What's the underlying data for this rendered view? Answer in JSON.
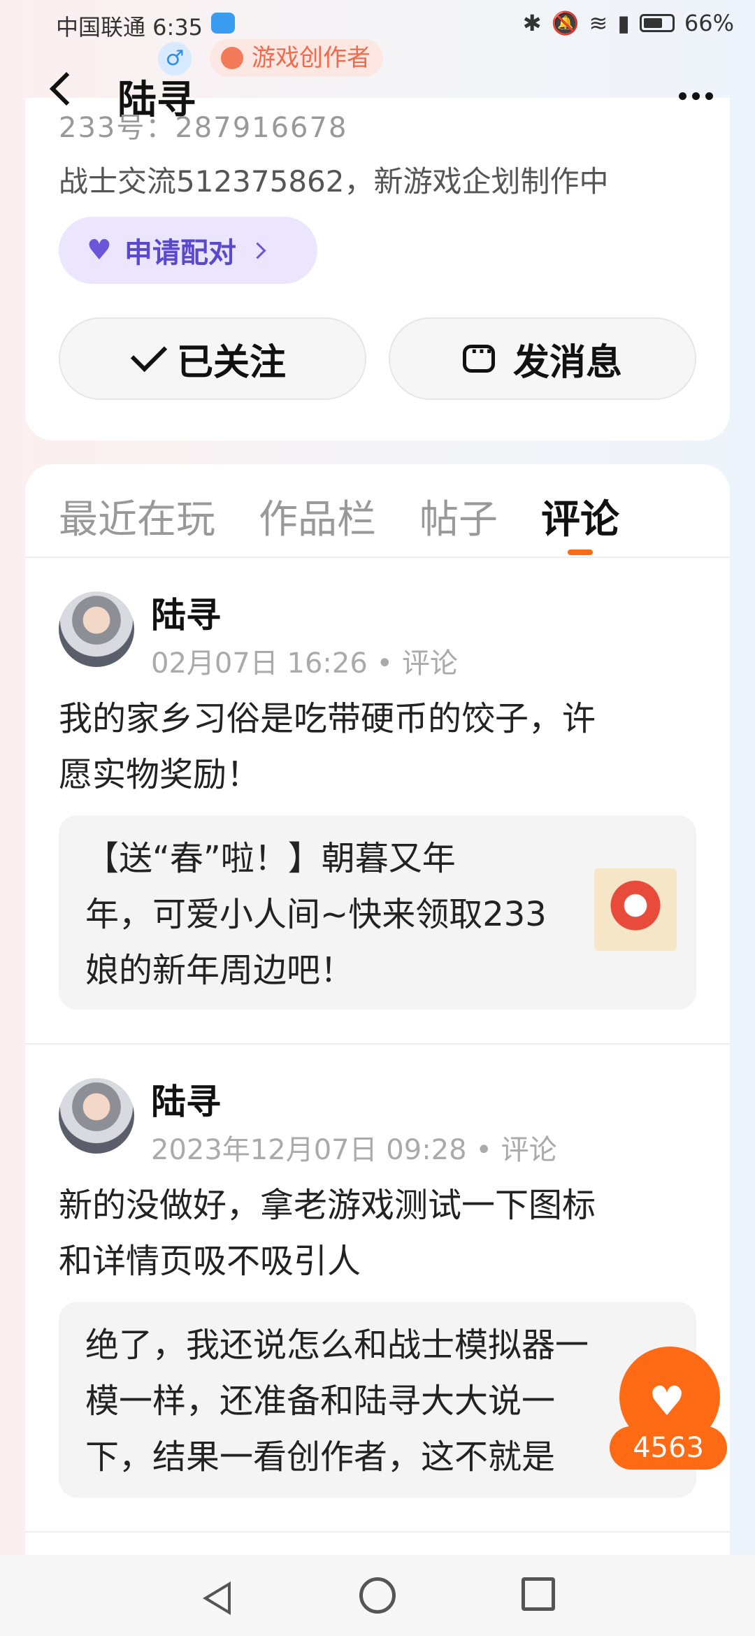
{
  "status_bar": {
    "carrier_time": "中国联通 6:35",
    "battery": "66%"
  },
  "header": {
    "title": "陆寻",
    "gender": "♂",
    "badge": "游戏创作者"
  },
  "profile": {
    "uid": "233号：287916678",
    "bio": "战士交流512375862，新游戏企划制作中",
    "match_label": "申请配对",
    "follow_label": "已关注",
    "message_label": "发消息"
  },
  "tabs": [
    {
      "label": "最近在玩"
    },
    {
      "label": "作品栏"
    },
    {
      "label": "帖子"
    },
    {
      "label": "评论",
      "active": true
    }
  ],
  "comments": [
    {
      "author": "陆寻",
      "date": "02月07日 16:26",
      "type": "评论",
      "text_line1": "我的家乡习俗是吃带硬币的饺子，许",
      "text_line2": "愿实物奖励！",
      "quote_line1": "【送“春”啦！】朝暮又年",
      "quote_line2": "年，可爱小人间~快来领取233",
      "quote_line3": "娘的新年周边吧！"
    },
    {
      "author": "陆寻",
      "date": "2023年12月07日 09:28",
      "type": "评论",
      "text_line1": "新的没做好，拿老游戏测试一下图标",
      "text_line2": "和详情页吸不吸引人",
      "quote_line1": "绝了，我还说怎么和战士模拟器一",
      "quote_line2": "模一样，还准备和陆寻大大说一",
      "quote_line3": "下，结果一看创作者，这不就是"
    }
  ],
  "like": {
    "count": "4563"
  },
  "colors": {
    "accent": "#ff6a14",
    "match_purple": "#5b48d0",
    "creator_orange": "#f06a4c"
  }
}
